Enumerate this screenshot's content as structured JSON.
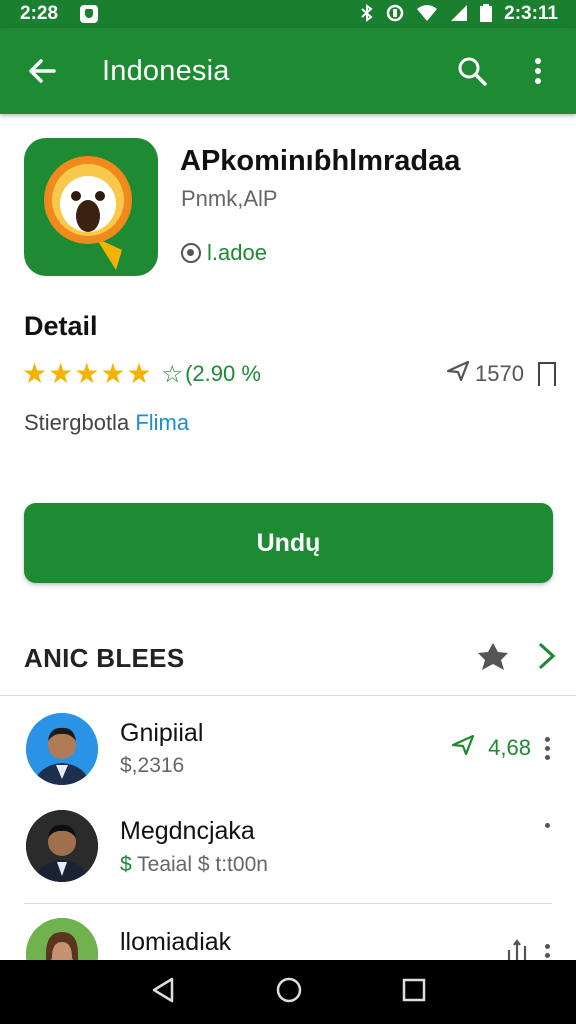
{
  "status_bar": {
    "time_left": "2:28",
    "time_right": "2:3:11",
    "colors": {
      "bar": "#1a7f2e"
    }
  },
  "app_bar": {
    "title": "Indonesia",
    "icons": [
      "back-arrow-icon",
      "search-icon",
      "more-vert-icon"
    ]
  },
  "app": {
    "name": "APkominıɓhlmradaa",
    "developer": "Pnmk,AlP",
    "badge": "l.adoe"
  },
  "detail": {
    "title": "Detail",
    "rating_count": "(2.90 %",
    "downloads": "1570",
    "category_label": "Stiergbotla",
    "category_link": "Flima"
  },
  "install_button": {
    "label": "Undų"
  },
  "section": {
    "title": "ANIC BLEES"
  },
  "list": [
    {
      "name": "Gnipiial",
      "sub": "$,2316",
      "right_value": "4,68"
    },
    {
      "name": "Megdncjaka",
      "sub_icon": "$",
      "sub_a": "Teaial",
      "sub_b": "$ t:t00n"
    },
    {
      "name": "llomiadiak"
    }
  ],
  "colors": {
    "primary": "#1e8a33",
    "star": "#f5b301",
    "link": "#1a8fd1"
  }
}
